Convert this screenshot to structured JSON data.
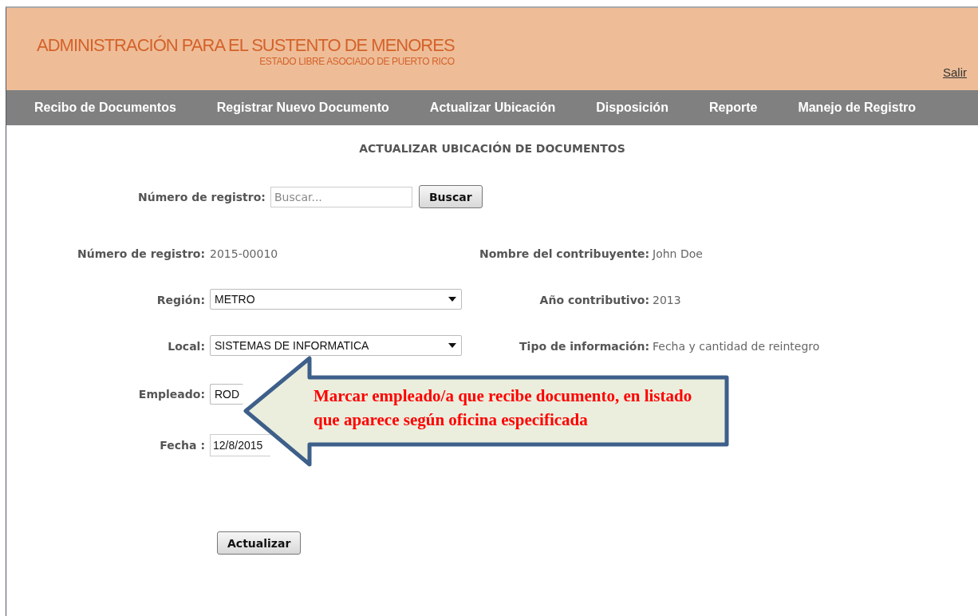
{
  "header": {
    "title": "ADMINISTRACIÓN PARA EL SUSTENTO DE MENORES",
    "subtitle": "ESTADO LIBRE ASOCIADO DE PUERTO RICO",
    "logout": "Salir"
  },
  "nav": [
    "Recibo de Documentos",
    "Registrar Nuevo Documento",
    "Actualizar Ubicación",
    "Disposición",
    "Reporte",
    "Manejo de Registro"
  ],
  "page_title": "ACTUALIZAR UBICACIÓN DE DOCUMENTOS",
  "search": {
    "label": "Número de registro:",
    "placeholder": "Buscar...",
    "button": "Buscar"
  },
  "rows": [
    {
      "left": {
        "kind": "text",
        "label": "Número de registro:",
        "value": "2015-00010"
      },
      "right": {
        "label": "Nombre del contribuyente:",
        "value": "John Doe"
      }
    },
    {
      "left": {
        "kind": "select",
        "label": "Región:",
        "value": "METRO"
      },
      "right": {
        "label": "Año contributivo:",
        "value": "2013"
      }
    },
    {
      "left": {
        "kind": "select",
        "label": "Local:",
        "value": "SISTEMAS DE INFORMATICA"
      },
      "right": {
        "label": "Tipo de información:",
        "value": "Fecha y cantidad de reintegro"
      }
    },
    {
      "left": {
        "kind": "select",
        "label": "Empleado:",
        "value": "ROD"
      }
    },
    {
      "left": {
        "kind": "input",
        "label": "Fecha :",
        "value": "12/8/2015"
      }
    }
  ],
  "submit": "Actualizar",
  "callout": {
    "text": "Marcar empleado/a que recibe documento, en listado que aparece según oficina especificada"
  }
}
